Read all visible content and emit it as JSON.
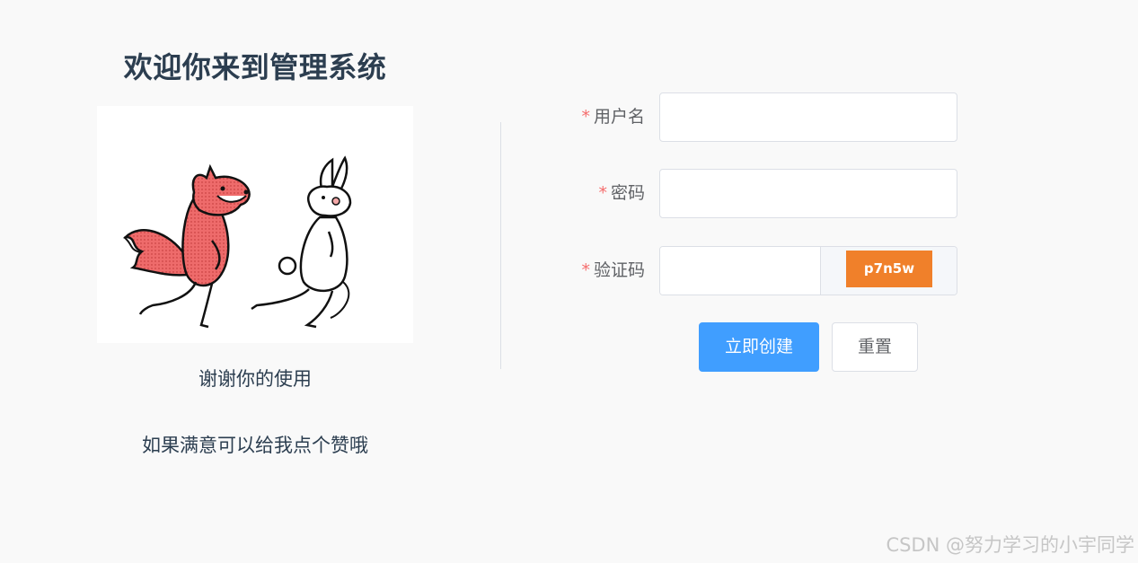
{
  "left_panel": {
    "title": "欢迎你来到管理系统",
    "thanks_text": "谢谢你的使用",
    "like_text": "如果满意可以给我点个赞哦"
  },
  "form": {
    "username": {
      "required_mark": "*",
      "label": "用户名",
      "value": "",
      "placeholder": ""
    },
    "password": {
      "required_mark": "*",
      "label": "密码",
      "value": "",
      "placeholder": ""
    },
    "captcha": {
      "required_mark": "*",
      "label": "验证码",
      "value": "",
      "placeholder": "",
      "code_text": "p7n5w",
      "code_bg_color": "#f0802a"
    },
    "buttons": {
      "submit_label": "立即创建",
      "reset_label": "重置"
    }
  },
  "colors": {
    "accent": "#409eff",
    "required": "#f56c6c",
    "text_dark": "#2c3e50"
  },
  "watermark": "CSDN @努力学习的小宇同学"
}
